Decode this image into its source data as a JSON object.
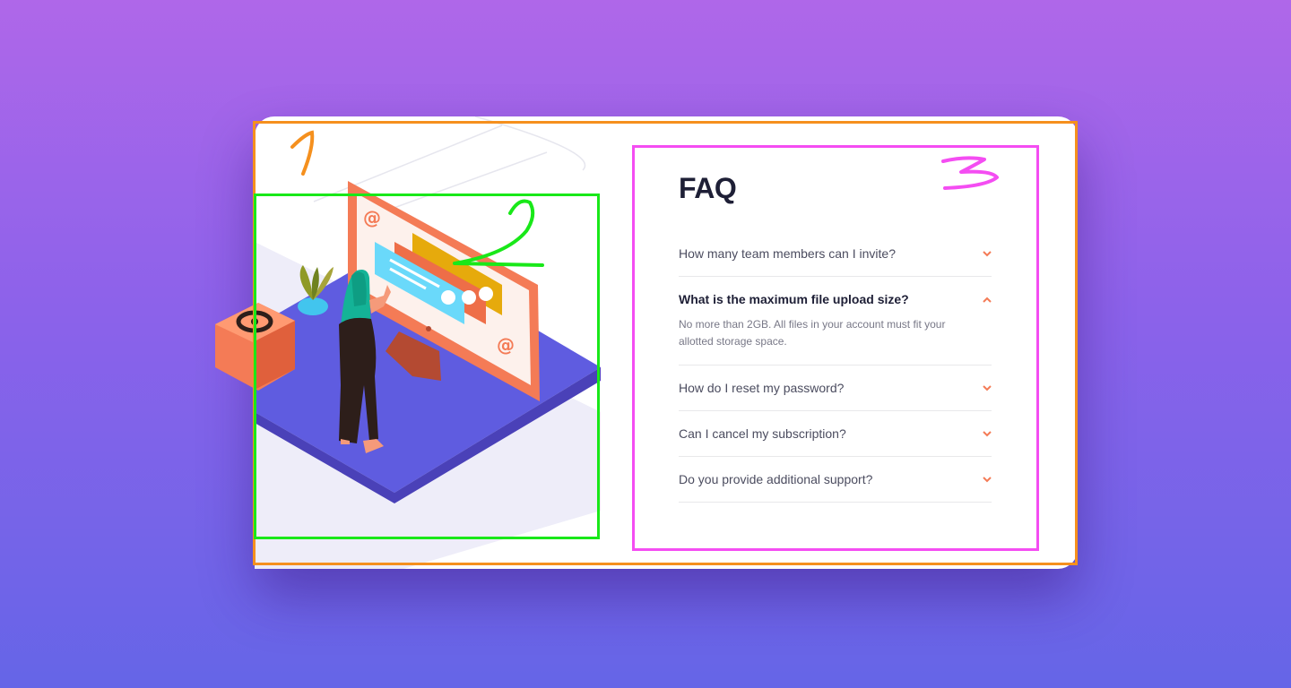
{
  "faq": {
    "title": "FAQ",
    "items": [
      {
        "question": "How many team members can I invite?",
        "open": false
      },
      {
        "question": "What is the maximum file upload size?",
        "open": true,
        "answer": "No more than 2GB. All files in your account must fit your allotted storage space."
      },
      {
        "question": "How do I reset my password?",
        "open": false
      },
      {
        "question": "Can I cancel my subscription?",
        "open": false
      },
      {
        "question": "Do you provide additional support?",
        "open": false
      }
    ]
  },
  "annotations": {
    "labels": [
      "1",
      "2",
      "3"
    ],
    "colors": {
      "1": "#f5901e",
      "2": "#19e819",
      "3": "#f44df2"
    }
  },
  "icons": {
    "chevron": "chevron-down-icon",
    "chevron_open": "chevron-up-icon",
    "at_symbol": "at-sign-icon"
  },
  "colors": {
    "background_top": "#af67e9",
    "background_bottom": "#6565e7",
    "accent": "#f47b56",
    "heading": "#1e1f36",
    "text": "#4b4c5f"
  }
}
